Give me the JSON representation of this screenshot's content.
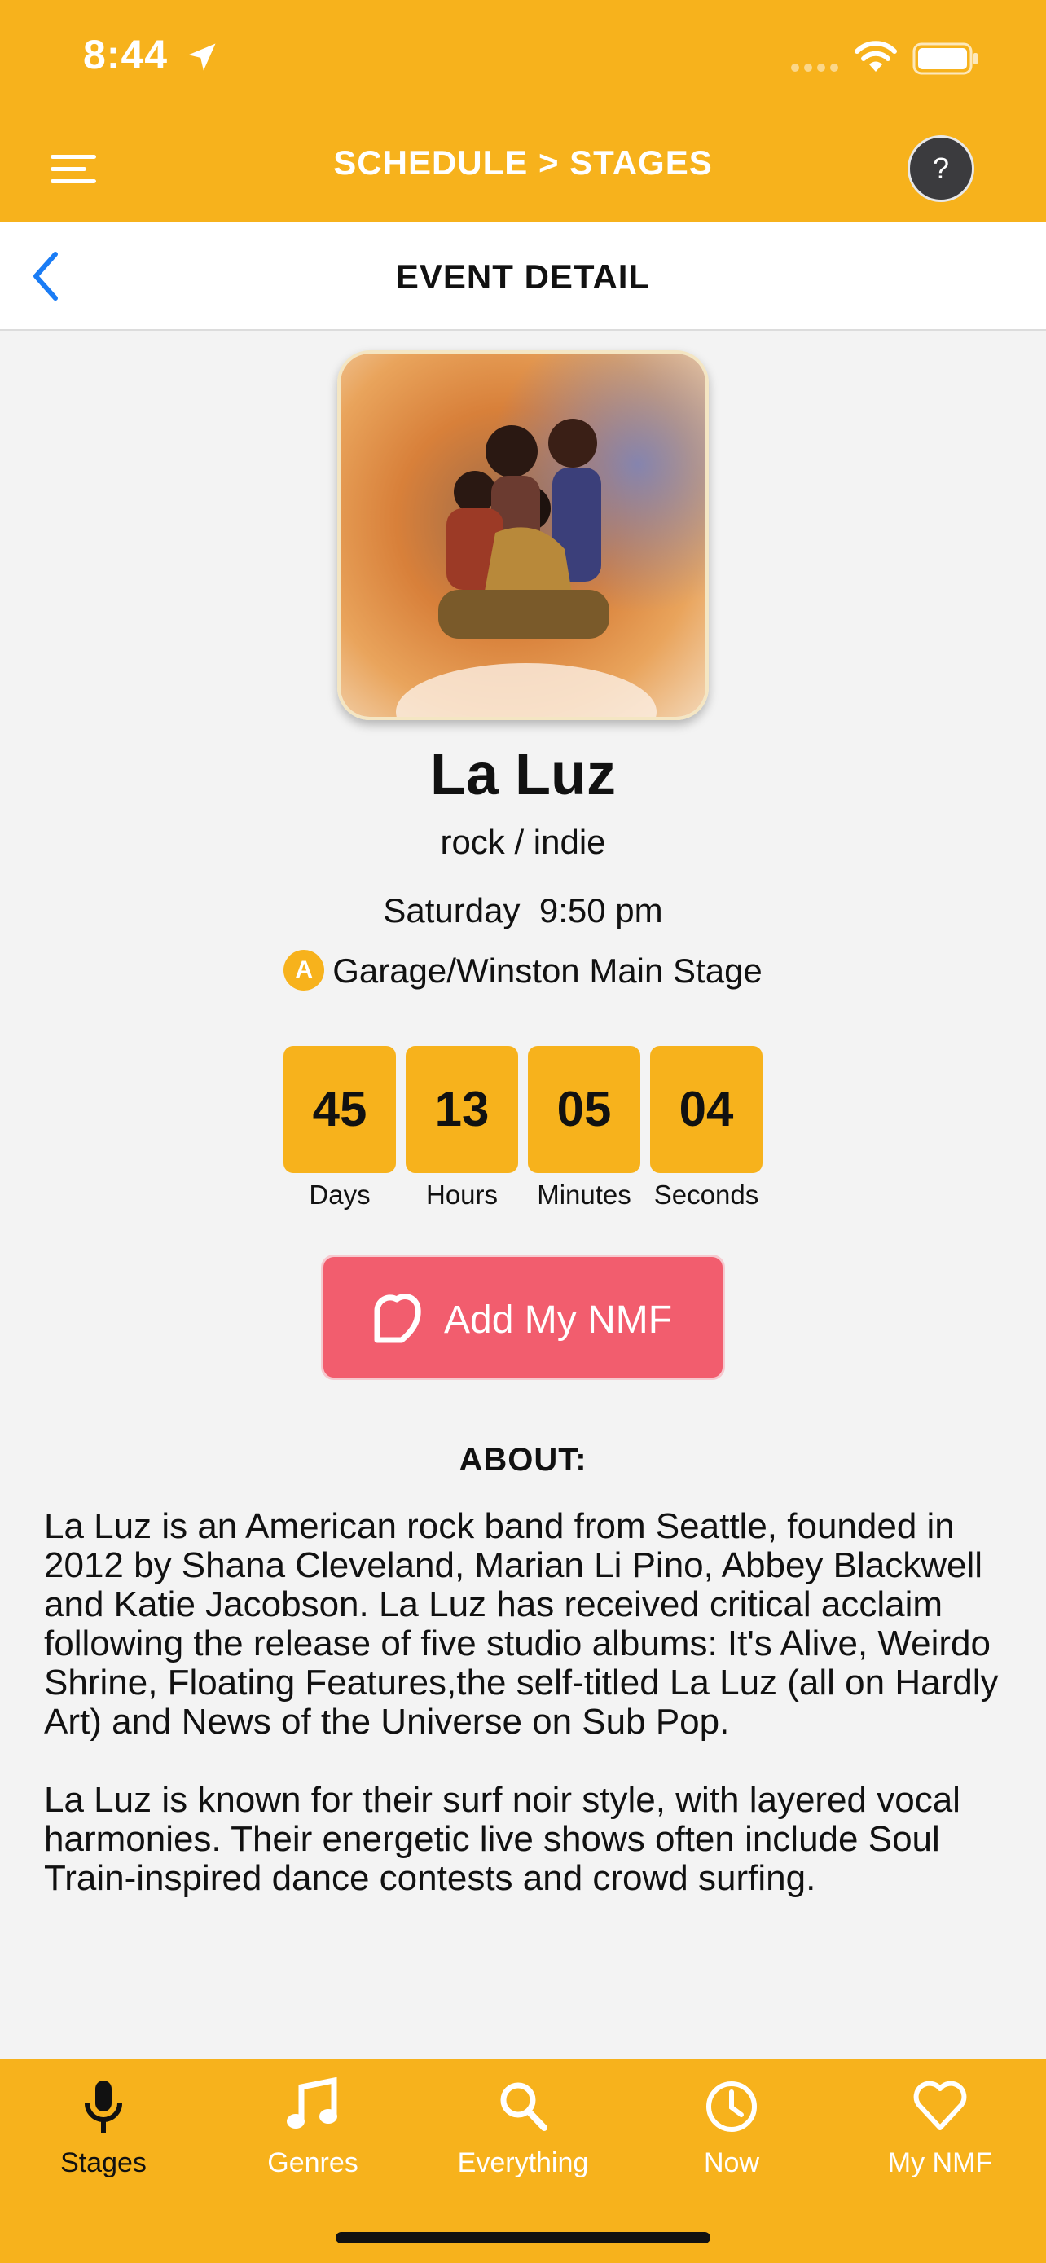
{
  "status_bar": {
    "time": "8:44"
  },
  "header": {
    "title": "SCHEDULE > STAGES",
    "help_label": "?"
  },
  "subheader": {
    "title": "EVENT DETAIL"
  },
  "event": {
    "name": "La Luz",
    "genre": "rock / indie",
    "day_time": "Saturday  9:50 pm",
    "stage_badge": "A",
    "stage": "Garage/Winston Main Stage"
  },
  "countdown": [
    {
      "value": "45",
      "label": "Days"
    },
    {
      "value": "13",
      "label": "Hours"
    },
    {
      "value": "05",
      "label": "Minutes"
    },
    {
      "value": "04",
      "label": "Seconds"
    }
  ],
  "add_button": {
    "label": "Add My NMF"
  },
  "about": {
    "title": "ABOUT:",
    "paragraphs": [
      "La Luz is an American rock band from Seattle, founded in 2012 by Shana Cleveland, Marian Li Pino, Abbey Blackwell and Katie Jacobson. La Luz has received critical acclaim following the release of five studio albums: It's Alive, Weirdo Shrine, Floating Features,the self-titled La Luz (all on Hardly Art) and News of the Universe on Sub Pop.",
      "La Luz is known for their surf noir style, with layered vocal harmonies. Their energetic live shows often include Soul Train-inspired dance contests and crowd surfing."
    ]
  },
  "bottom_nav": [
    {
      "label": "Stages",
      "icon": "microphone-icon",
      "active": true
    },
    {
      "label": "Genres",
      "icon": "music-note-icon",
      "active": false
    },
    {
      "label": "Everything",
      "icon": "search-icon",
      "active": false
    },
    {
      "label": "Now",
      "icon": "clock-icon",
      "active": false
    },
    {
      "label": "My NMF",
      "icon": "heart-icon",
      "active": false
    }
  ],
  "colors": {
    "accent": "#f7b21c",
    "add_button": "#f25d6e",
    "back_link": "#1a7cf5"
  }
}
